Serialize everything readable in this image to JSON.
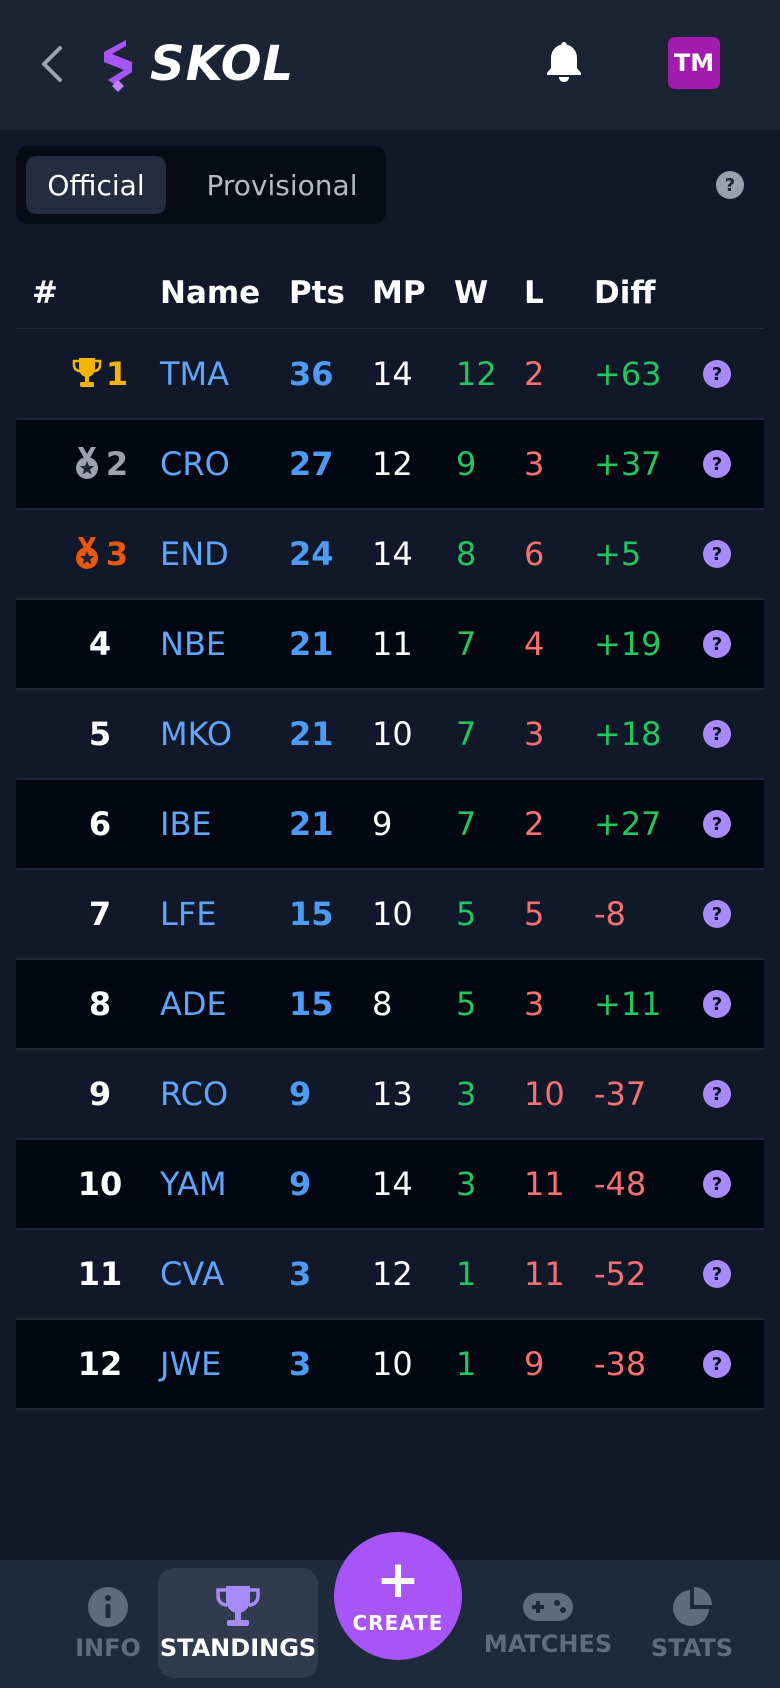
{
  "header": {
    "brand": "SKOL",
    "avatar_initials": "TM",
    "colors": {
      "brand_purple": "#a855f7",
      "avatar": "#a21caf"
    }
  },
  "tabs": {
    "official": "Official",
    "provisional": "Provisional",
    "active": "official"
  },
  "help_glyph": "?",
  "table": {
    "columns": {
      "rank": "#",
      "name": "Name",
      "pts": "Pts",
      "mp": "MP",
      "w": "W",
      "l": "L",
      "diff": "Diff"
    },
    "rows": [
      {
        "rank": "1",
        "name": "TMA",
        "pts": "36",
        "mp": "14",
        "w": "12",
        "l": "2",
        "diff": "+63",
        "medal": "trophy-icon",
        "medal_color": "#f5b400"
      },
      {
        "rank": "2",
        "name": "CRO",
        "pts": "27",
        "mp": "12",
        "w": "9",
        "l": "3",
        "diff": "+37",
        "medal": "silver-medal-icon",
        "medal_color": "#9ca3af"
      },
      {
        "rank": "3",
        "name": "END",
        "pts": "24",
        "mp": "14",
        "w": "8",
        "l": "6",
        "diff": "+5",
        "medal": "bronze-medal-icon",
        "medal_color": "#ea580c"
      },
      {
        "rank": "4",
        "name": "NBE",
        "pts": "21",
        "mp": "11",
        "w": "7",
        "l": "4",
        "diff": "+19"
      },
      {
        "rank": "5",
        "name": "MKO",
        "pts": "21",
        "mp": "10",
        "w": "7",
        "l": "3",
        "diff": "+18"
      },
      {
        "rank": "6",
        "name": "IBE",
        "pts": "21",
        "mp": "9",
        "w": "7",
        "l": "2",
        "diff": "+27"
      },
      {
        "rank": "7",
        "name": "LFE",
        "pts": "15",
        "mp": "10",
        "w": "5",
        "l": "5",
        "diff": "-8"
      },
      {
        "rank": "8",
        "name": "ADE",
        "pts": "15",
        "mp": "8",
        "w": "5",
        "l": "3",
        "diff": "+11"
      },
      {
        "rank": "9",
        "name": "RCO",
        "pts": "9",
        "mp": "13",
        "w": "3",
        "l": "10",
        "diff": "-37"
      },
      {
        "rank": "10",
        "name": "YAM",
        "pts": "9",
        "mp": "14",
        "w": "3",
        "l": "11",
        "diff": "-48"
      },
      {
        "rank": "11",
        "name": "CVA",
        "pts": "3",
        "mp": "12",
        "w": "1",
        "l": "11",
        "diff": "-52"
      },
      {
        "rank": "12",
        "name": "JWE",
        "pts": "3",
        "mp": "10",
        "w": "1",
        "l": "9",
        "diff": "-38"
      }
    ]
  },
  "nav": {
    "info": "INFO",
    "standings": "STANDINGS",
    "create": "CREATE",
    "create_glyph": "+",
    "matches": "MATCHES",
    "stats": "STATS",
    "active": "standings"
  }
}
